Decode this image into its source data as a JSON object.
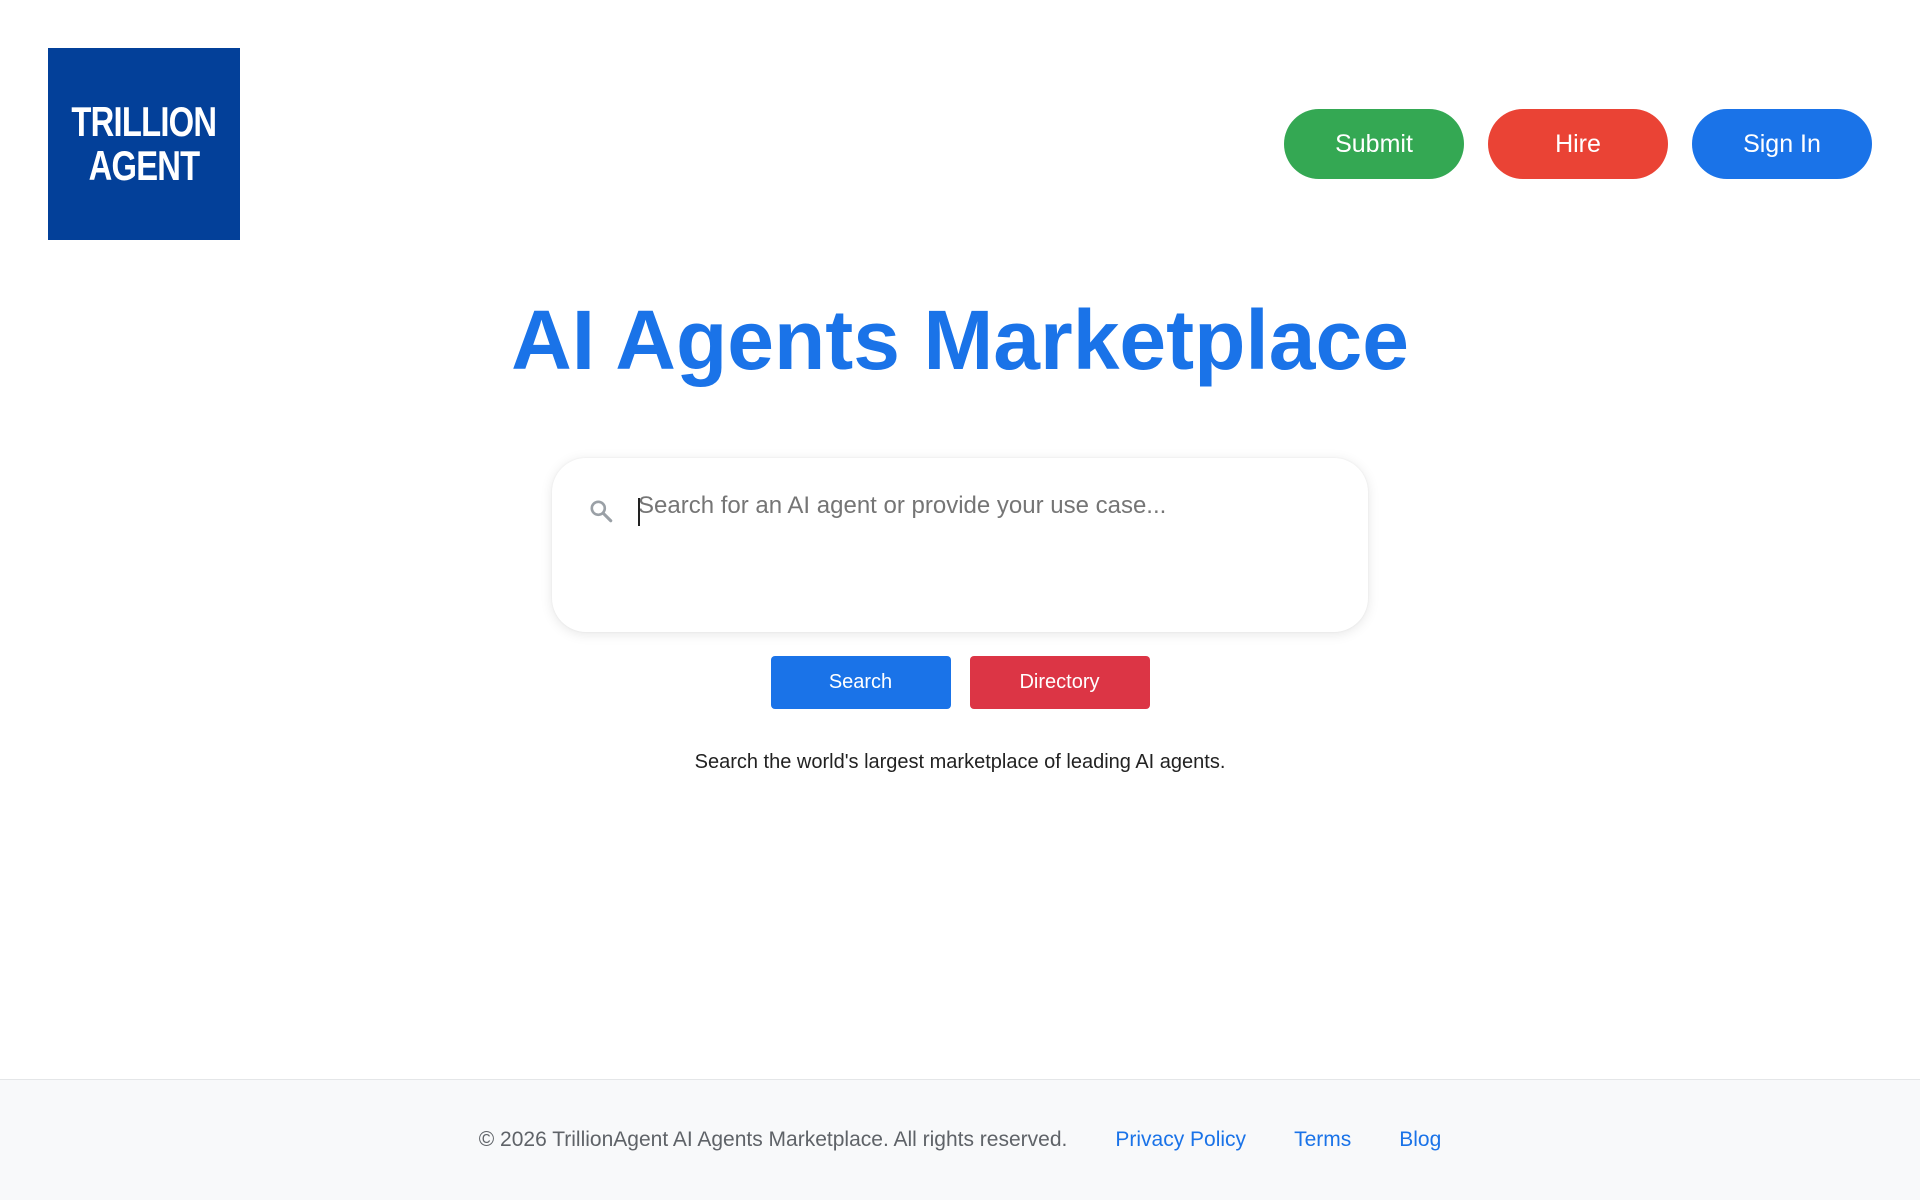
{
  "logo": {
    "line1": "TRILLION",
    "line2": "AGENT",
    "background": "#034099"
  },
  "header": {
    "submit_label": "Submit",
    "hire_label": "Hire",
    "signin_label": "Sign In"
  },
  "hero": {
    "title": "AI Agents Marketplace"
  },
  "search": {
    "icon": "search-icon",
    "placeholder": "Search for an AI agent or provide your use case...",
    "value": ""
  },
  "actions": {
    "search_label": "Search",
    "directory_label": "Directory"
  },
  "tagline": "Search the world's largest marketplace of leading AI agents.",
  "footer": {
    "copyright": "© 2026 TrillionAgent AI Agents Marketplace. All rights reserved.",
    "links": [
      {
        "label": "Privacy Policy"
      },
      {
        "label": "Terms"
      },
      {
        "label": "Blog"
      }
    ]
  },
  "colors": {
    "primary": "#1a73e8",
    "submit": "#34a853",
    "hire": "#ea4335",
    "directory": "#dc3545"
  }
}
